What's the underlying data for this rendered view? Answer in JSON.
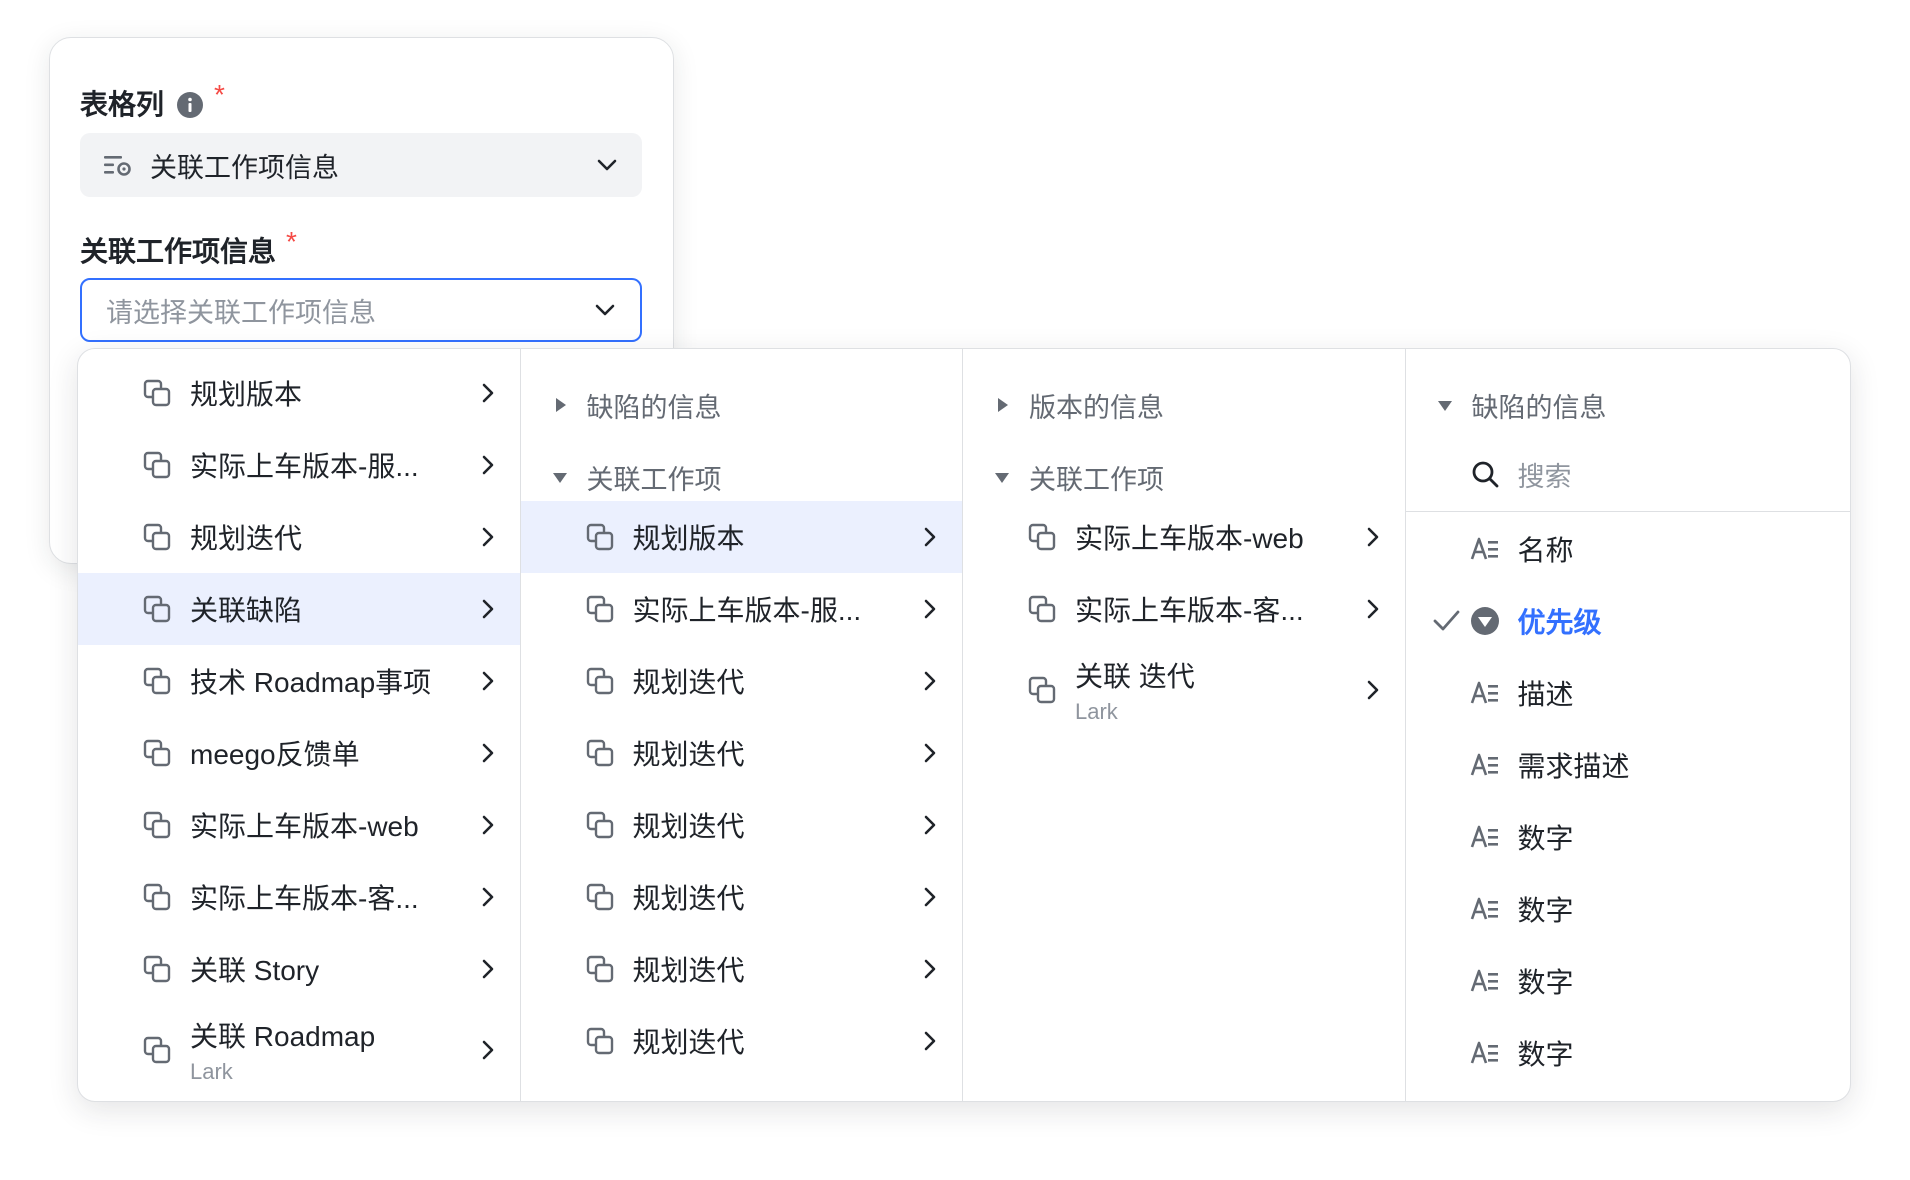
{
  "form": {
    "field1": {
      "label": "表格列",
      "required_mark": "*",
      "value": "关联工作项信息"
    },
    "field2": {
      "label": "关联工作项信息",
      "required_mark": "*",
      "placeholder": "请选择关联工作项信息"
    }
  },
  "cascader": {
    "col1": {
      "items": [
        {
          "label": "规划版本"
        },
        {
          "label": "实际上车版本-服..."
        },
        {
          "label": "规划迭代"
        },
        {
          "label": "关联缺陷",
          "selected": true
        },
        {
          "label": "技术 Roadmap事项"
        },
        {
          "label": "meego反馈单"
        },
        {
          "label": "实际上车版本-web"
        },
        {
          "label": "实际上车版本-客..."
        },
        {
          "label": "关联 Story"
        },
        {
          "label": "关联 Roadmap",
          "sub": "Lark"
        }
      ]
    },
    "col2": {
      "group1": "缺陷的信息",
      "group2": "关联工作项",
      "items": [
        {
          "label": "规划版本",
          "selected": true
        },
        {
          "label": "实际上车版本-服..."
        },
        {
          "label": "规划迭代"
        },
        {
          "label": "规划迭代"
        },
        {
          "label": "规划迭代"
        },
        {
          "label": "规划迭代"
        },
        {
          "label": "规划迭代"
        },
        {
          "label": "规划迭代"
        }
      ]
    },
    "col3": {
      "group1": "版本的信息",
      "group2": "关联工作项",
      "items": [
        {
          "label": "实际上车版本-web"
        },
        {
          "label": "实际上车版本-客..."
        },
        {
          "label": "关联 迭代",
          "sub": "Lark"
        }
      ]
    },
    "col4": {
      "group": "缺陷的信息",
      "search_placeholder": "搜索",
      "items": [
        {
          "label": "名称"
        },
        {
          "label": "优先级",
          "checked": true
        },
        {
          "label": "描述"
        },
        {
          "label": "需求描述"
        },
        {
          "label": "数字"
        },
        {
          "label": "数字"
        },
        {
          "label": "数字"
        },
        {
          "label": "数字"
        }
      ]
    }
  },
  "colors": {
    "accent": "#3370ff",
    "selected_bg": "#ebf0fe",
    "required": "#f54a45"
  }
}
